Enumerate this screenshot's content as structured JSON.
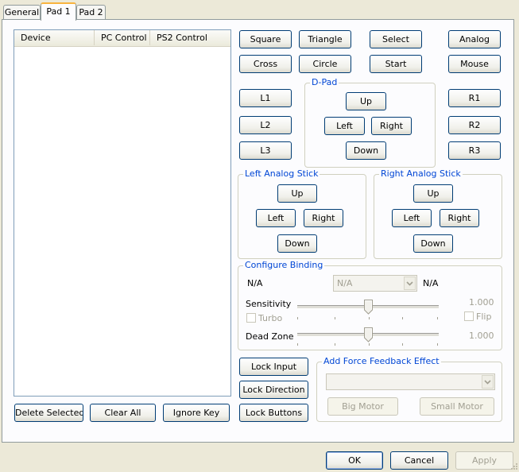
{
  "tabs": [
    "General",
    "Pad 1",
    "Pad 2"
  ],
  "device_list": {
    "columns": [
      "Device",
      "PC Control",
      "PS2 Control"
    ]
  },
  "buttons": {
    "square": "Square",
    "triangle": "Triangle",
    "select": "Select",
    "analog": "Analog",
    "cross": "Cross",
    "circle": "Circle",
    "start": "Start",
    "mouse": "Mouse",
    "l1": "L1",
    "l2": "L2",
    "l3": "L3",
    "r1": "R1",
    "r2": "R2",
    "r3": "R3"
  },
  "dpad": {
    "label": "D-Pad",
    "up": "Up",
    "left": "Left",
    "right": "Right",
    "down": "Down"
  },
  "left_stick": {
    "label": "Left Analog Stick",
    "up": "Up",
    "left": "Left",
    "right": "Right",
    "down": "Down"
  },
  "right_stick": {
    "label": "Right Analog Stick",
    "up": "Up",
    "left": "Left",
    "right": "Right",
    "down": "Down"
  },
  "configure_binding": {
    "label": "Configure Binding",
    "binding_left": "N/A",
    "binding_select": "N/A",
    "binding_right": "N/A",
    "sensitivity_label": "Sensitivity",
    "sensitivity_value": "1.000",
    "turbo_label": "Turbo",
    "flip_label": "Flip",
    "deadzone_label": "Dead Zone",
    "deadzone_value": "1.000"
  },
  "list_actions": {
    "delete_selected": "Delete Selected",
    "clear_all": "Clear All",
    "ignore_key": "Ignore Key"
  },
  "lock_buttons": {
    "lock_input": "Lock Input",
    "lock_direction": "Lock Direction",
    "lock_buttons": "Lock Buttons"
  },
  "force_feedback": {
    "label": "Add Force Feedback Effect",
    "select_value": "",
    "big_motor": "Big Motor",
    "small_motor": "Small Motor"
  },
  "dialog": {
    "ok": "OK",
    "cancel": "Cancel",
    "apply": "Apply"
  },
  "colors": {
    "background": "#ece9d8",
    "panel": "#fcfcfe",
    "group_label": "#0046d5",
    "button_border": "#003c74",
    "active_tab_accent": "#f8b33e",
    "disabled_text": "#a19f92"
  }
}
